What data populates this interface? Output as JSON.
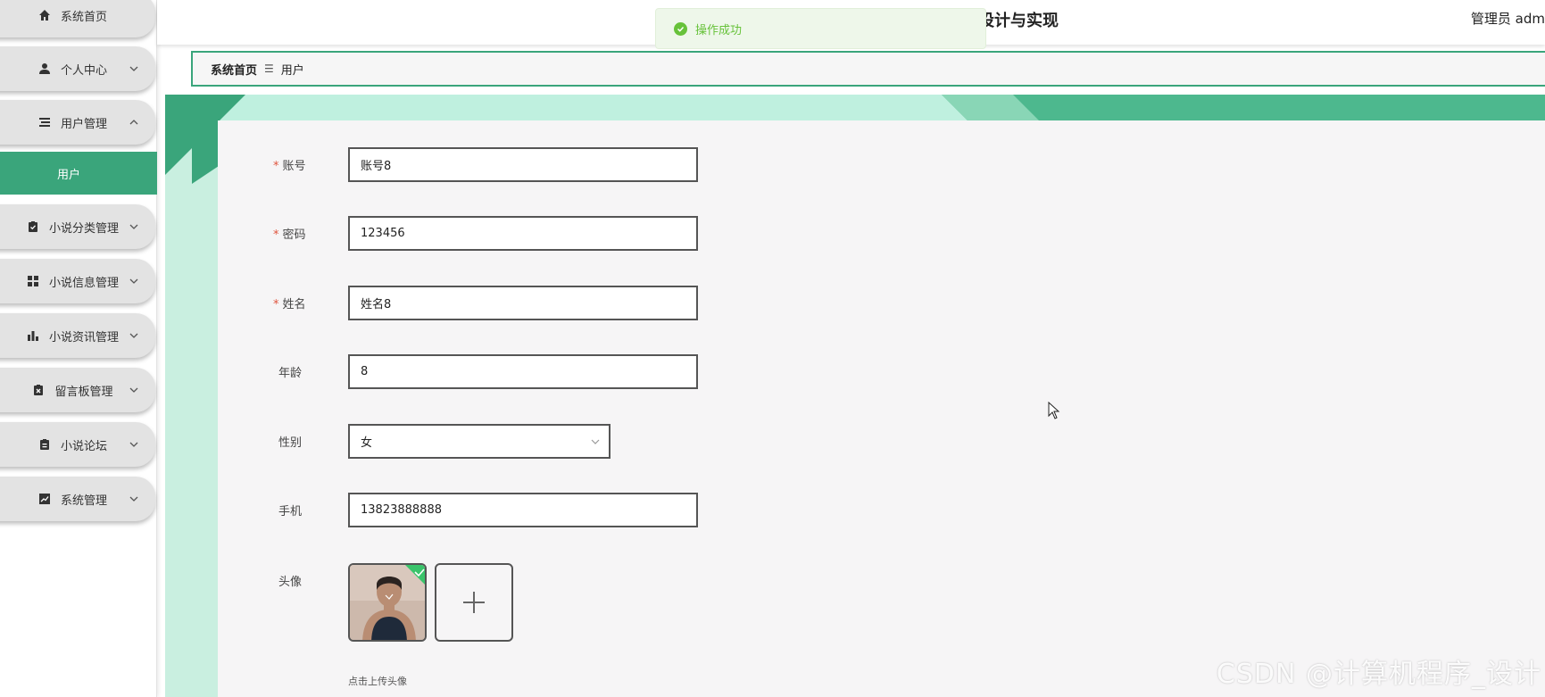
{
  "sidebar": {
    "items": [
      {
        "label": "系统首页",
        "icon": "home-icon",
        "chevron": "none"
      },
      {
        "label": "个人中心",
        "icon": "person-icon",
        "chevron": "down"
      },
      {
        "label": "用户管理",
        "icon": "list-icon",
        "chevron": "up"
      },
      {
        "label": "小说分类管理",
        "icon": "clipboard-check-icon",
        "chevron": "down"
      },
      {
        "label": "小说信息管理",
        "icon": "grid-icon",
        "chevron": "down"
      },
      {
        "label": "小说资讯管理",
        "icon": "bar-chart-icon",
        "chevron": "down"
      },
      {
        "label": "留言板管理",
        "icon": "clipboard-x-icon",
        "chevron": "down"
      },
      {
        "label": "小说论坛",
        "icon": "clipboard-icon",
        "chevron": "down"
      },
      {
        "label": "系统管理",
        "icon": "trend-chart-icon",
        "chevron": "down"
      }
    ],
    "active_sub": "用户"
  },
  "header": {
    "title_fragment": "设计与实现",
    "user": "管理员 adm"
  },
  "toast": {
    "message": "操作成功",
    "color": "#67c23a"
  },
  "breadcrumb": {
    "home": "系统首页",
    "separator": "☰",
    "current": "用户"
  },
  "form": {
    "account": {
      "label": "账号",
      "value": "账号8",
      "required": true
    },
    "password": {
      "label": "密码",
      "value": "123456",
      "required": true
    },
    "name": {
      "label": "姓名",
      "value": "姓名8",
      "required": true
    },
    "age": {
      "label": "年龄",
      "value": "8",
      "required": false
    },
    "gender": {
      "label": "性别",
      "value": "女",
      "required": false
    },
    "phone": {
      "label": "手机",
      "value": "13823888888",
      "required": false
    },
    "avatar": {
      "label": "头像",
      "hint": "点击上传头像"
    }
  },
  "watermark": "CSDN @计算机程序_设计",
  "colors": {
    "accent": "#3aa57b",
    "success": "#67c23a",
    "required": "#e0543e"
  }
}
